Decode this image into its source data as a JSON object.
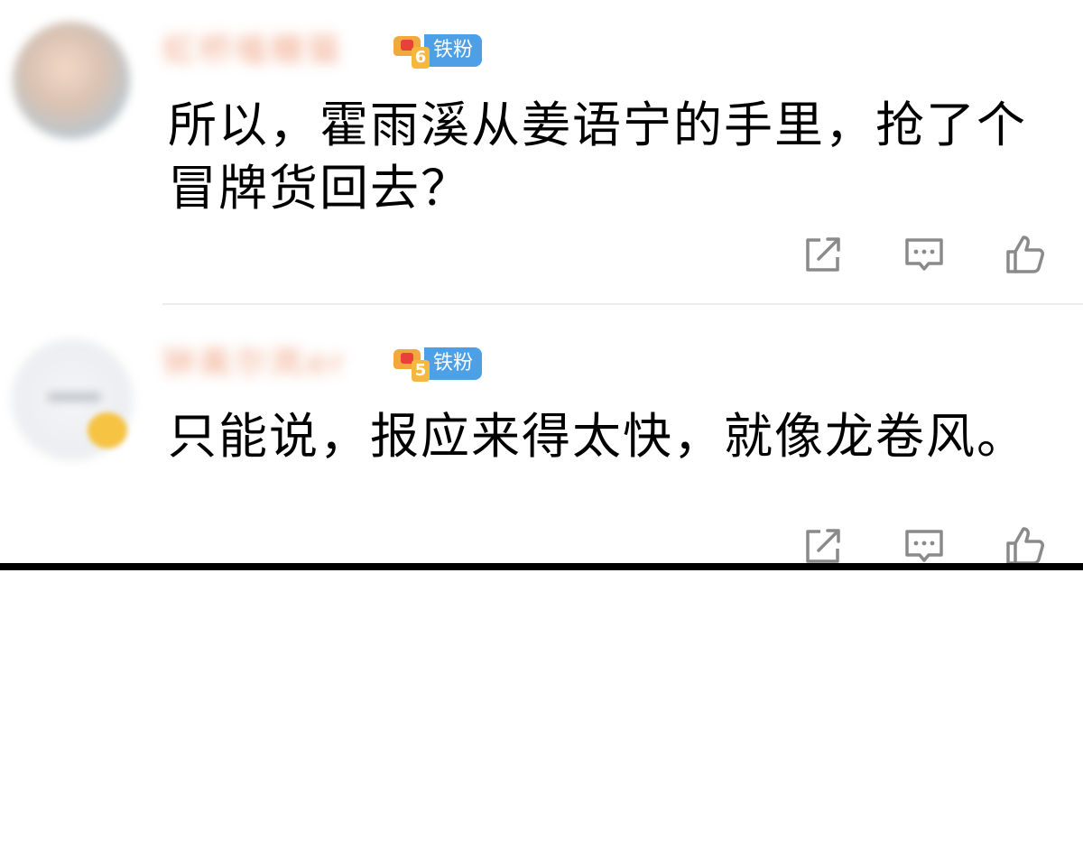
{
  "comments": [
    {
      "username": "虹桥嗑糖猫",
      "badge": {
        "level": "6",
        "label": "铁粉"
      },
      "text": "所以，霍雨溪从姜语宁的手里，抢了个冒牌货回去？"
    },
    {
      "username": "钟离尔岚er",
      "badge": {
        "level": "5",
        "label": "铁粉"
      },
      "text": "只能说，报应来得太快，就像龙卷风。"
    }
  ],
  "icons": {
    "repost": "repost-icon",
    "reply": "comment-icon",
    "like": "thumbs-up-icon"
  },
  "colors": {
    "badge_blue": "#4d9fe6",
    "crown_orange": "#f2a93b",
    "icon_gray": "#8a8a8a",
    "text": "#000000"
  }
}
